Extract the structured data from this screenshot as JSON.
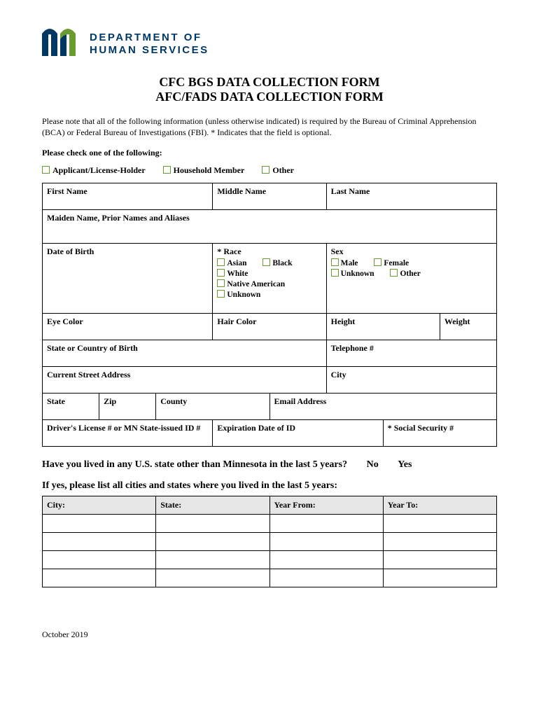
{
  "logo": {
    "line1": "DEPARTMENT OF",
    "line2": "HUMAN SERVICES"
  },
  "title": {
    "line1": "CFC BGS DATA COLLECTION FORM",
    "line2": "AFC/FADS DATA COLLECTION FORM"
  },
  "intro": "Please note that all of the following information (unless otherwise indicated) is required by the Bureau of Criminal Apprehension (BCA) or Federal Bureau of Investigations (FBI).  * Indicates that the field is optional.",
  "checkHeader": "Please check one of the following:",
  "checkOptions": {
    "applicant": "Applicant/License-Holder",
    "household": "Household Member",
    "other": "Other"
  },
  "fields": {
    "firstName": "First Name",
    "middleName": "Middle Name",
    "lastName": "Last Name",
    "maiden": "Maiden Name, Prior Names and Aliases",
    "dob": "Date of Birth",
    "raceLabel": "* Race",
    "race": {
      "asian": "Asian",
      "black": "Black",
      "white": "White",
      "native": "Native American",
      "unknown": "Unknown"
    },
    "sexLabel": "Sex",
    "sex": {
      "male": "Male",
      "female": "Female",
      "unknown": "Unknown",
      "other": "Other"
    },
    "eye": "Eye Color",
    "hair": "Hair Color",
    "height": "Height",
    "weight": "Weight",
    "birthState": "State or Country of Birth",
    "telephone": "Telephone #",
    "address": "Current Street Address",
    "city": "City",
    "state": "State",
    "zip": "Zip",
    "county": "County",
    "email": "Email Address",
    "dl": "Driver's License # or MN State-issued ID #",
    "expiration": "Expiration Date of ID",
    "ssn": "* Social Security #"
  },
  "question": {
    "text": "Have you lived in any U.S. state other than Minnesota in the last 5 years?",
    "no": "No",
    "yes": "Yes"
  },
  "question2": "If yes, please list all cities and states where you lived in the last 5 years:",
  "historyHeaders": {
    "city": "City:",
    "state": "State:",
    "yearFrom": "Year From:",
    "yearTo": "Year To:"
  },
  "footer": "October 2019"
}
